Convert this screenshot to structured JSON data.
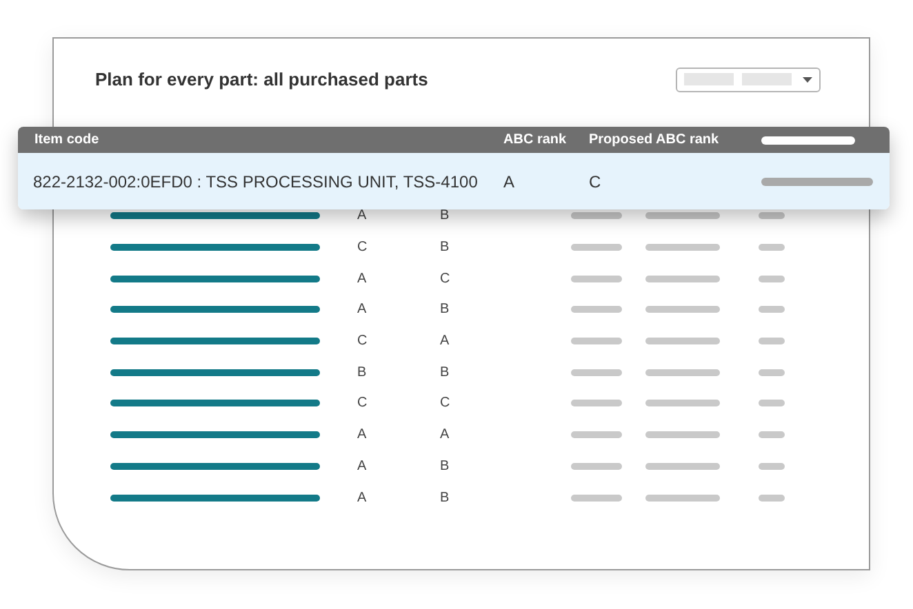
{
  "title": "Plan for every part: all purchased parts",
  "columns": [
    "Item code",
    "ABC rank",
    "Proposed ABC rank"
  ],
  "highlighted_row": {
    "item_code": "822-2132-002:0EFD0 : TSS PROCESSING UNIT, TSS-4100",
    "abc_rank": "A",
    "proposed_abc_rank": "C"
  },
  "rows": [
    {
      "abc_rank": "A",
      "proposed_abc_rank": "B"
    },
    {
      "abc_rank": "C",
      "proposed_abc_rank": "B"
    },
    {
      "abc_rank": "A",
      "proposed_abc_rank": "C"
    },
    {
      "abc_rank": "A",
      "proposed_abc_rank": "B"
    },
    {
      "abc_rank": "C",
      "proposed_abc_rank": "A"
    },
    {
      "abc_rank": "B",
      "proposed_abc_rank": "B"
    },
    {
      "abc_rank": "C",
      "proposed_abc_rank": "C"
    },
    {
      "abc_rank": "A",
      "proposed_abc_rank": "A"
    },
    {
      "abc_rank": "A",
      "proposed_abc_rank": "B"
    },
    {
      "abc_rank": "A",
      "proposed_abc_rank": "B"
    }
  ]
}
